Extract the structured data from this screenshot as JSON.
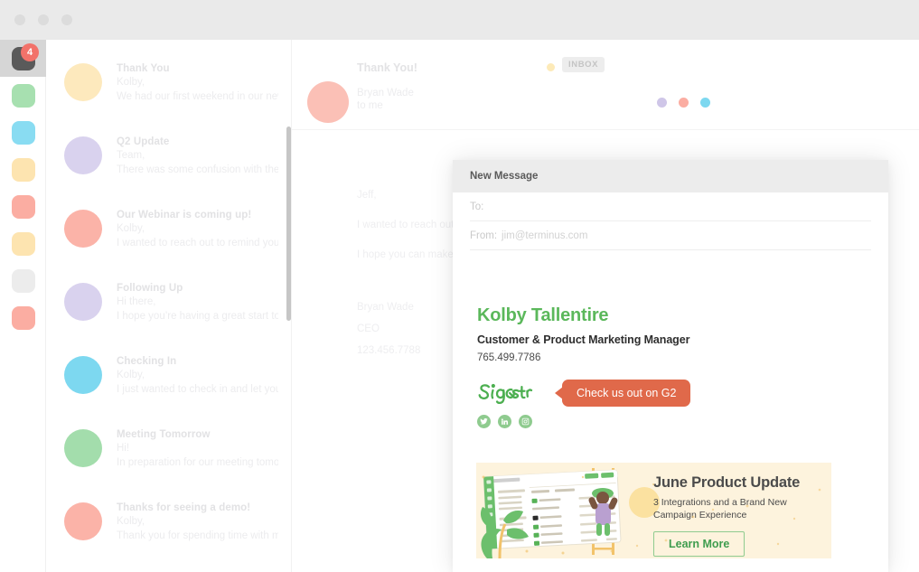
{
  "window": {
    "traffic_lights": [
      "close",
      "minimize",
      "maximize"
    ]
  },
  "icon_rail": {
    "items": [
      {
        "name": "inbox",
        "color": "#5a5a5a",
        "active": true,
        "badge": "4"
      },
      {
        "name": "folder-green",
        "color": "#a7e0b0",
        "active": false,
        "badge": ""
      },
      {
        "name": "folder-blue",
        "color": "#89dcf2",
        "active": false,
        "badge": ""
      },
      {
        "name": "folder-yellow",
        "color": "#fde4b0",
        "active": false,
        "badge": ""
      },
      {
        "name": "folder-salmon",
        "color": "#fbada2",
        "active": false,
        "badge": ""
      },
      {
        "name": "folder-cream",
        "color": "#fde4b0",
        "active": false,
        "badge": ""
      },
      {
        "name": "folder-grey",
        "color": "#ececec",
        "active": false,
        "badge": ""
      },
      {
        "name": "folder-pink",
        "color": "#fbada2",
        "active": false,
        "badge": ""
      }
    ]
  },
  "email_list": {
    "items": [
      {
        "subject": "Thank You",
        "line1": "Kolby,",
        "line2": "We had our first weekend in our newly",
        "avatar_color": "#fde9bd"
      },
      {
        "subject": "Q2 Update",
        "line1": "Team,",
        "line2": "There was some confusion with the ti",
        "avatar_color": "#d9d2ee"
      },
      {
        "subject": "Our Webinar is coming up!",
        "line1": "Kolby,",
        "line2": "I wanted to reach out to remind you o",
        "avatar_color": "#fbb3a8"
      },
      {
        "subject": "Following Up",
        "line1": "Hi there,",
        "line2": "I hope you’re having a great start to th",
        "avatar_color": "#d9d2ee"
      },
      {
        "subject": "Checking In",
        "line1": "Kolby,",
        "line2": "I just wanted to check in and let you k",
        "avatar_color": "#7dd8f0"
      },
      {
        "subject": "Meeting Tomorrow",
        "line1": "Hi!",
        "line2": "In preparation for our meeting tomorr",
        "avatar_color": "#a3ddac"
      },
      {
        "subject": "Thanks for seeing a demo!",
        "line1": "Kolby,",
        "line2": "Thank you for spending time with me",
        "avatar_color": "#fbb3a8"
      }
    ]
  },
  "thread": {
    "subject": "Thank You!",
    "sender": "Bryan Wade",
    "recipient": "to me",
    "label": "INBOX",
    "label_dot_color": "#fdeab8",
    "dots": [
      "#cfc6e8",
      "#fbada2",
      "#7dd8f0"
    ],
    "body": {
      "greeting": "Jeff,",
      "paragraph1": "I wanted to reach out t",
      "paragraph2": "I hope you can make it!",
      "sign_name": "Bryan Wade",
      "sign_title": "CEO",
      "sign_phone": "123.456.7788"
    }
  },
  "compose": {
    "title": "New Message",
    "to_label": "To:",
    "to_value": "",
    "from_label": "From:",
    "from_value": "jim@terminus.com",
    "signature": {
      "name": "Kolby Tallentire",
      "name_color": "#5bb85b",
      "role": "Customer & Product Marketing Manager",
      "phone": "765.499.7786",
      "logo_text": "Sigstr",
      "callout": "Check us out on G2",
      "callout_color": "#e0694a",
      "social": [
        "twitter-icon",
        "linkedin-icon",
        "instagram-icon"
      ]
    },
    "banner": {
      "title": "June Product Update",
      "subtitle": "3 Integrations and a Brand New Campaign Experience",
      "cta": "Learn More",
      "background": "#fdf3dd",
      "cta_color": "#3f9d4f"
    }
  }
}
